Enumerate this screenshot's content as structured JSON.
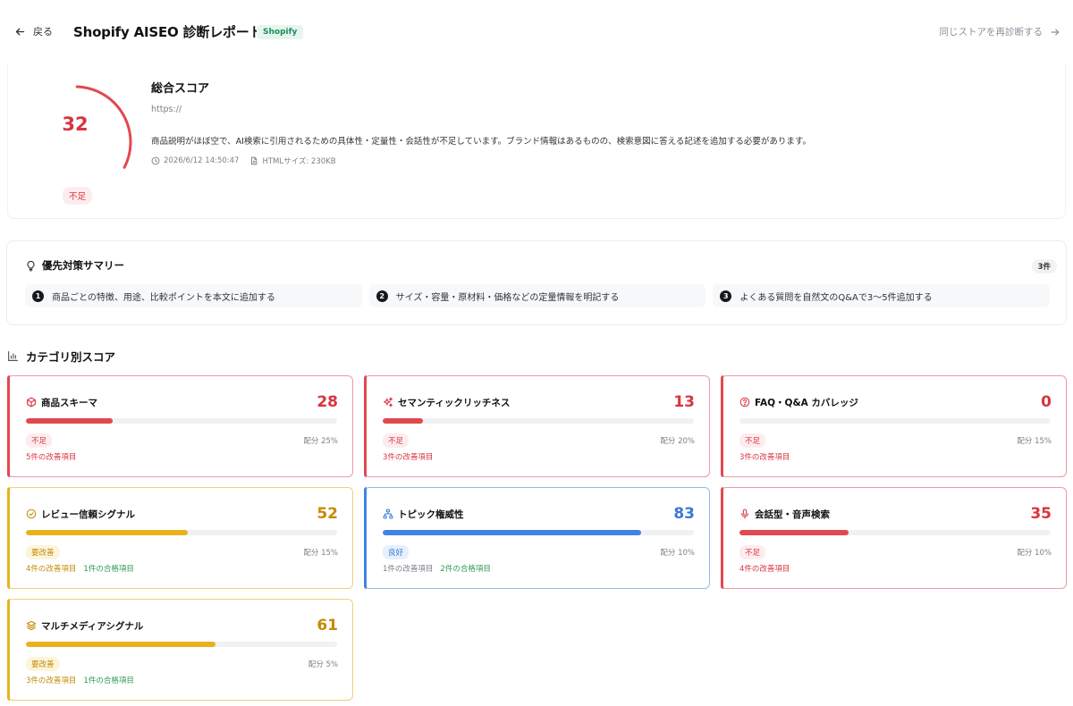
{
  "header": {
    "back_label": "戻る",
    "title": "Shopify AISEO 診断レポート",
    "platform_badge": "Shopify",
    "rescan_label": "同じストアを再診断する"
  },
  "overall": {
    "score": "32",
    "score_value": 32,
    "status": "不足",
    "heading": "総合スコア",
    "url": "https://",
    "description": "商品説明がほぼ空で、AI検索に引用されるための具体性・定量性・会話性が不足しています。ブランド情報はあるものの、検索意図に答える記述を追加する必要があります。",
    "timestamp": "2026/6/12 14:50:47",
    "html_size": "HTMLサイズ: 230KB"
  },
  "summary": {
    "title": "優先対策サマリー",
    "count": "3件",
    "items": [
      {
        "num": "1",
        "text": "商品ごとの特徴、用途、比較ポイントを本文に追加する"
      },
      {
        "num": "2",
        "text": "サイズ・容量・原材料・価格などの定量情報を明記する"
      },
      {
        "num": "3",
        "text": "よくある質問を自然文のQ&Aで3〜5件追加する"
      }
    ]
  },
  "categories_title": "カテゴリ別スコア",
  "categories": [
    {
      "name": "商品スキーマ",
      "score": "28",
      "value": 28,
      "status": "不足",
      "weight": "配分 25%",
      "improve": "5件の改善項目",
      "passed": "",
      "level": "red",
      "icon": "cube-icon"
    },
    {
      "name": "セマンティックリッチネス",
      "score": "13",
      "value": 13,
      "status": "不足",
      "weight": "配分 20%",
      "improve": "3件の改善項目",
      "passed": "",
      "level": "red",
      "icon": "sparkles-icon"
    },
    {
      "name": "FAQ・Q&A カバレッジ",
      "score": "0",
      "value": 0,
      "status": "不足",
      "weight": "配分 15%",
      "improve": "3件の改善項目",
      "passed": "",
      "level": "red",
      "icon": "question-circle-icon"
    },
    {
      "name": "レビュー信頼シグナル",
      "score": "52",
      "value": 52,
      "status": "要改善",
      "weight": "配分 15%",
      "improve": "4件の改善項目",
      "passed": "1件の合格項目",
      "level": "yellow",
      "icon": "check-circle-icon"
    },
    {
      "name": "トピック権威性",
      "score": "83",
      "value": 83,
      "status": "良好",
      "weight": "配分 10%",
      "improve": "1件の改善項目",
      "passed": "2件の合格項目",
      "level": "blue",
      "icon": "network-icon"
    },
    {
      "name": "会話型・音声検索",
      "score": "35",
      "value": 35,
      "status": "不足",
      "weight": "配分 10%",
      "improve": "4件の改善項目",
      "passed": "",
      "level": "red",
      "icon": "microphone-icon"
    },
    {
      "name": "マルチメディアシグナル",
      "score": "61",
      "value": 61,
      "status": "要改善",
      "weight": "配分 5%",
      "improve": "3件の改善項目",
      "passed": "1件の合格項目",
      "level": "yellow",
      "icon": "layers-icon"
    }
  ],
  "colors": {
    "red": "#e2484f",
    "yellow": "#e7b21c",
    "blue": "#3f83e6",
    "pass": "#2f9a57"
  }
}
